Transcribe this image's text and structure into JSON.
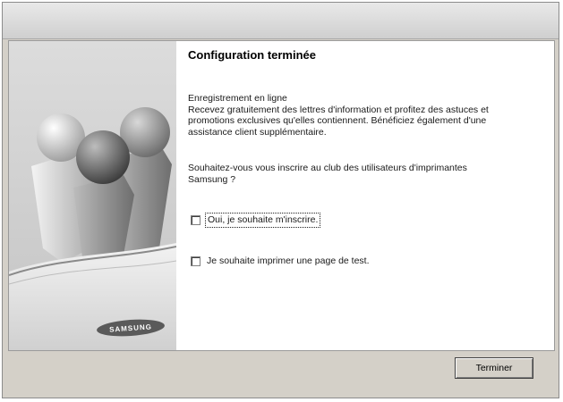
{
  "dialog": {
    "heading": "Configuration terminée",
    "intro_lines": [
      "Enregistrement en ligne",
      "Recevez gratuitement des lettres d'information et profitez des astuces et",
      "promotions exclusives qu'elles contiennent. Bénéficiez également d'une",
      "assistance client supplémentaire."
    ],
    "question_lines": [
      "Souhaitez-vous vous inscrire au club des utilisateurs d'imprimantes",
      "Samsung ?"
    ],
    "options": [
      {
        "label": "Oui, je souhaite m'inscrire.",
        "checked": false
      },
      {
        "label": "Je souhaite imprimer une page de test.",
        "checked": false
      }
    ],
    "finish_label": "Terminer"
  },
  "sidebar": {
    "logo_text": "SAMSUNG",
    "logo_icon": "samsung-logo-icon",
    "artwork_icon": "users-spheres-illustration-icon"
  }
}
